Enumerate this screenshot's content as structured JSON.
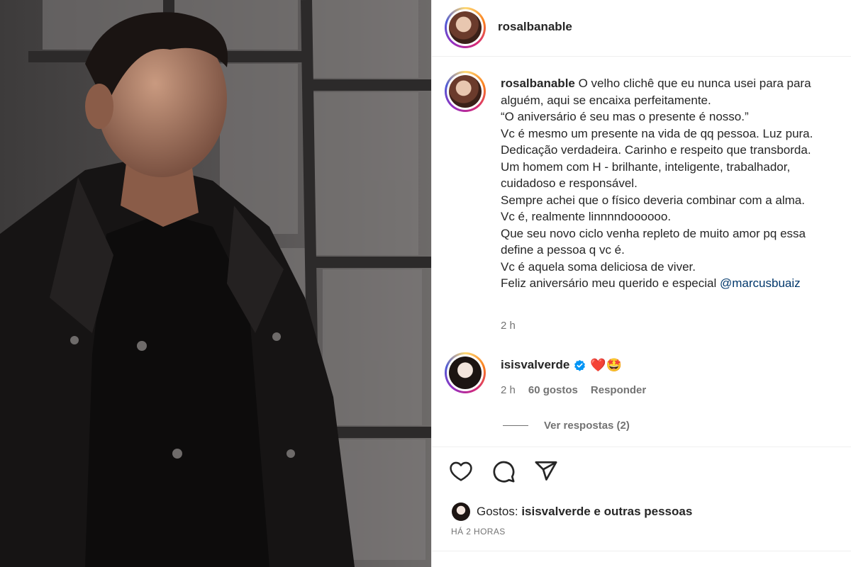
{
  "post": {
    "author": "rosalbanable",
    "caption_lines": [
      "O velho clichê que eu nunca usei para para",
      "alguém, aqui se encaixa perfeitamente.",
      "“O aniversário é seu mas o presente é nosso.”",
      "Vc é mesmo um presente na vida de qq pessoa. Luz pura.",
      "Dedicação verdadeira. Carinho e respeito que transborda.",
      "Um homem com H - brilhante, inteligente, trabalhador,",
      "cuidadoso e responsável.",
      "Sempre achei que o físico deveria combinar com a alma.",
      "Vc é, realmente linnnndoooooo.",
      "Que seu novo ciclo venha repleto de muito amor pq essa",
      "define a pessoa q vc é.",
      "Vc é aquela soma deliciosa de viver.",
      "Feliz aniversário meu querido e especial"
    ],
    "mention": "@marcusbuaiz",
    "caption_time": "2 h"
  },
  "comment": {
    "user": "isisvalverde",
    "emojis": "❤️🤩",
    "time": "2 h",
    "likes": "60 gostos",
    "reply_label": "Responder",
    "view_replies": "Ver respostas (2)"
  },
  "likes": {
    "prefix": "Gostos:",
    "text": "isisvalverde e outras pessoas"
  },
  "posted_ago": "HÁ 2 HORAS",
  "icons": [
    "heart-icon",
    "comment-icon",
    "share-icon",
    "verified-icon"
  ],
  "colors": {
    "mention": "#00376b",
    "secondary": "#737373",
    "verified": "#0095f6"
  }
}
